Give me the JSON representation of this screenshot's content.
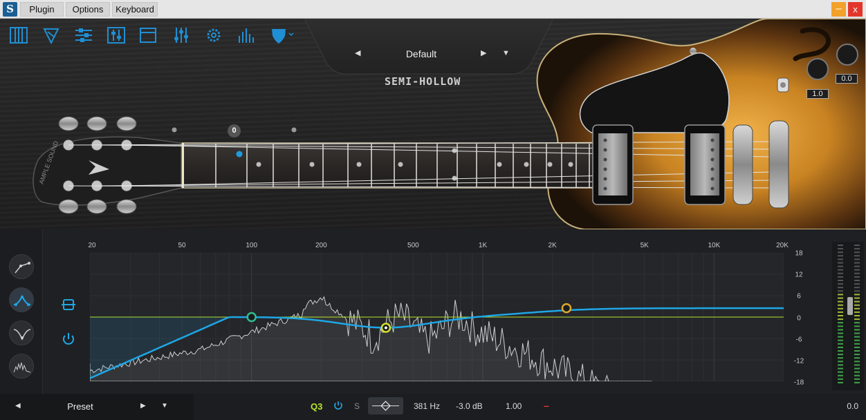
{
  "menubar": {
    "logo_glyph": "S",
    "items": [
      {
        "label": "Plugin"
      },
      {
        "label": "Options"
      },
      {
        "label": "Keyboard"
      }
    ],
    "minimize_glyph": "–",
    "close_glyph": "x"
  },
  "toolbar": {
    "icons": [
      "keyboard-icon",
      "guitar-pick-icon",
      "mixer-sliders-icon",
      "eq-sliders-icon",
      "window-icon",
      "sliders-icon",
      "gear-icon",
      "spectrum-icon",
      "shield-dropdown-icon"
    ],
    "accent": "#1f8fd6"
  },
  "preset": {
    "prev_glyph": "◀",
    "name": "Default",
    "next_glyph": "▶",
    "menu_glyph": "▼"
  },
  "product": {
    "title": "SEMI-HOLLOW"
  },
  "guitar": {
    "fret_position": "0",
    "knob_value_1": "1.0",
    "knob_value_2": "0.0",
    "headstock_brand": "AMPLE SOUND"
  },
  "eq": {
    "freq_labels": [
      "20",
      "50",
      "100",
      "200",
      "500",
      "1K",
      "2K",
      "5K",
      "10K",
      "20K"
    ],
    "db_labels": [
      "18",
      "12",
      "6",
      "0",
      "-6",
      "-12",
      "-18"
    ],
    "band_types": [
      "lowcut-type-icon",
      "bell-type-icon",
      "notch-type-icon",
      "spectrum-type-icon"
    ],
    "active_band_type": 1,
    "colors": {
      "curve": "#1ea7e6",
      "zero_line": "#b9e62b",
      "node1": "#2fbf8c",
      "node2": "#d2e02a",
      "node3": "#e0a82a"
    },
    "nodes": [
      {
        "freq_hz": 100,
        "gain_db": 0.0
      },
      {
        "freq_hz": 381,
        "gain_db": -3.0
      },
      {
        "freq_hz": 2300,
        "gain_db": 2.5
      }
    ],
    "selected_band": {
      "name": "Q3",
      "solo": "S",
      "freq": "381 Hz",
      "gain": "-3.0 dB",
      "q": "1.00",
      "remove": "–"
    },
    "preset_label": "Preset",
    "preset_prev_glyph": "◀",
    "preset_next_glyph": "▶",
    "preset_menu_glyph": "▼",
    "output_value": "0.0"
  }
}
